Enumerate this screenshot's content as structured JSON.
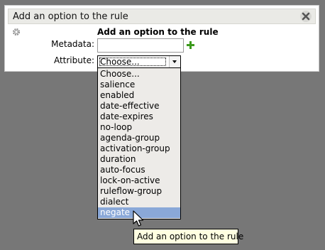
{
  "dialog": {
    "title": "Add an option to the rule",
    "heading": "Add an option to the rule",
    "metadata_label": "Metadata:",
    "metadata_value": "",
    "attribute_label": "Attribute:",
    "attribute_selected": "Choose...",
    "icons": {
      "close": "close-icon",
      "settings": "gear-icon",
      "add": "plus-icon"
    }
  },
  "attribute_options": [
    "Choose...",
    "salience",
    "enabled",
    "date-effective",
    "date-expires",
    "no-loop",
    "agenda-group",
    "activation-group",
    "duration",
    "auto-focus",
    "lock-on-active",
    "ruleflow-group",
    "dialect",
    "negate"
  ],
  "highlighted_option": "negate",
  "tooltip": {
    "text": "Add an option to the rule"
  },
  "colors": {
    "background": "#777777",
    "highlight": "#8aa8d8",
    "tooltip_bg": "#ffffe1",
    "plus_green": "#3c9a1c"
  }
}
